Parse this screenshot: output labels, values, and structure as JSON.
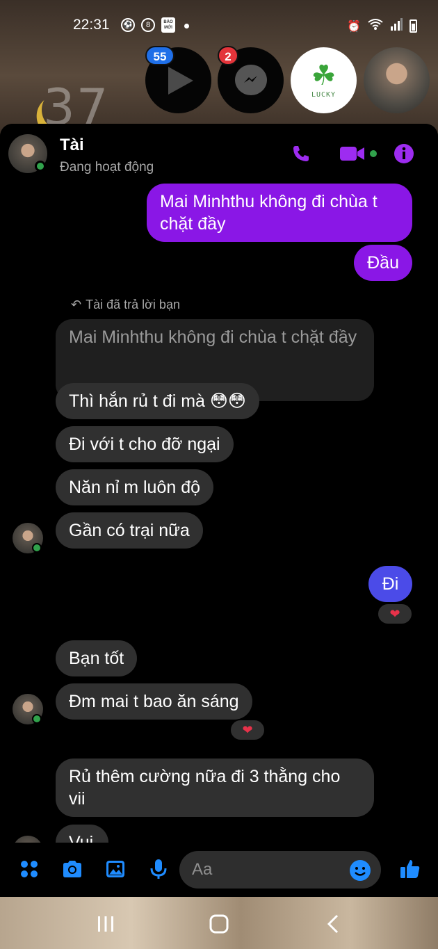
{
  "status_bar": {
    "time": "22:31",
    "news_badge": "BÁO MỚI"
  },
  "wallpaper": {
    "clock_digits": "37"
  },
  "chat_heads": {
    "video_badge": "55",
    "messenger_badge": "2",
    "lucky_label": "LUCKY"
  },
  "header": {
    "name": "Tài",
    "status": "Đang hoạt động"
  },
  "messages": {
    "m1": "Mai Minhthu không đi chùa t chặt đầy",
    "m2": "Đầu",
    "reply_note": "Tài đã trả lời bạn",
    "quoted": "Mai Minhthu không đi chùa t chặt đầy",
    "m3": "Thì hắn rủ t đi mà 😳😳",
    "m4": "Đi với t cho đỡ ngại",
    "m5": "Năn nỉ m luôn độ",
    "m6": "Gần có trại nữa",
    "m7": "Đi",
    "m8": "Bạn tốt",
    "m9": "Đm mai t bao ăn sáng",
    "m10": "Rủ thêm cường nữa đi 3 thằng cho vii",
    "m11": "Vui",
    "reaction": "❤"
  },
  "composer": {
    "placeholder": "Aa"
  },
  "colors": {
    "accent": "#8a17e6",
    "outgoing_bubble": "#8a17e6",
    "outgoing_bubble_last": "#4b4be8",
    "incoming_bubble": "#303030",
    "composer_icon": "#1f8cff",
    "online": "#31a24c"
  },
  "icons": {
    "header": [
      "phone-icon",
      "video-camera-icon",
      "info-icon"
    ],
    "composer": [
      "apps-icon",
      "camera-icon",
      "image-icon",
      "microphone-icon",
      "emoji-icon",
      "thumbs-up-icon"
    ],
    "navbar": [
      "recent-apps-icon",
      "home-icon",
      "back-icon"
    ]
  }
}
